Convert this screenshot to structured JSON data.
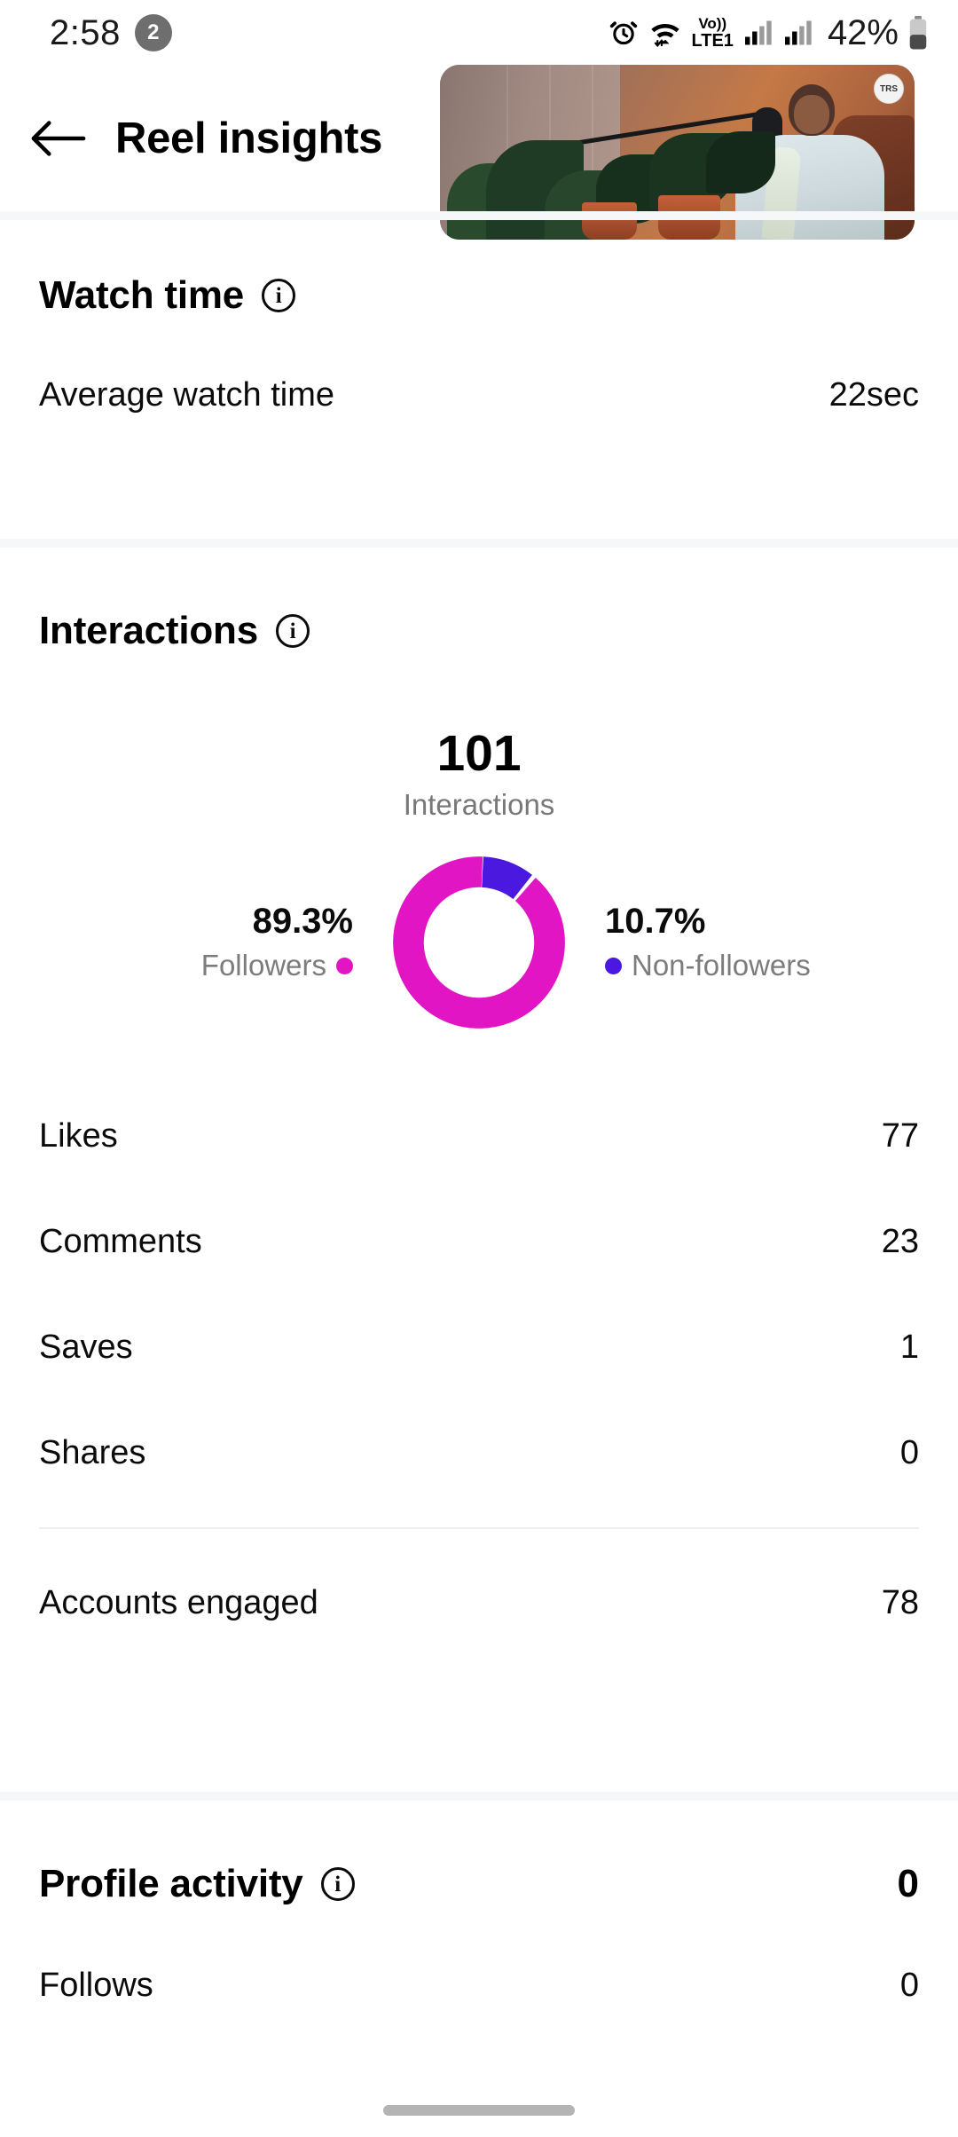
{
  "status_bar": {
    "time": "2:58",
    "notification_count": "2",
    "alarm_icon": "alarm-icon",
    "wifi_icon": "wifi-icon",
    "volte_line1": "Vo))",
    "volte_line2": "LTE1",
    "signal_icon_1": "signal-bars-icon",
    "signal_icon_2": "signal-bars-icon",
    "battery_percent": "42%",
    "battery_icon": "battery-icon"
  },
  "header": {
    "back_icon": "back-arrow-icon",
    "title": "Reel insights"
  },
  "thumbnail": {
    "name": "reel-thumbnail",
    "badge_label": "TRS"
  },
  "watch_time": {
    "title": "Watch time",
    "info_icon": "info-icon",
    "rows": [
      {
        "label": "Average watch time",
        "value": "22sec"
      }
    ]
  },
  "interactions": {
    "title": "Interactions",
    "info_icon": "info-icon",
    "total": "101",
    "total_label": "Interactions",
    "followers_pct": "89.3%",
    "followers_label": "Followers",
    "non_followers_pct": "10.7%",
    "non_followers_label": "Non-followers",
    "rows": [
      {
        "label": "Likes",
        "value": "77"
      },
      {
        "label": "Comments",
        "value": "23"
      },
      {
        "label": "Saves",
        "value": "1"
      },
      {
        "label": "Shares",
        "value": "0"
      }
    ],
    "accounts_engaged": {
      "label": "Accounts engaged",
      "value": "78"
    }
  },
  "profile_activity": {
    "title": "Profile activity",
    "info_icon": "info-icon",
    "value": "0",
    "rows": [
      {
        "label": "Follows",
        "value": "0"
      }
    ]
  },
  "colors": {
    "followers": "#E215C4",
    "non_followers": "#4A18DE",
    "section_divider": "#F6F7F9",
    "row_divider": "#EDEDF0",
    "muted_text": "#7C7C7C"
  },
  "chart_data": {
    "type": "pie",
    "title": "Interactions",
    "center_value": "101",
    "center_label": "Interactions",
    "categories": [
      "Followers",
      "Non-followers"
    ],
    "values": [
      89.3,
      10.7
    ],
    "value_unit": "%",
    "colors": [
      "#E215C4",
      "#4A18DE"
    ],
    "donut": true,
    "legend": "sides",
    "grid": false
  }
}
